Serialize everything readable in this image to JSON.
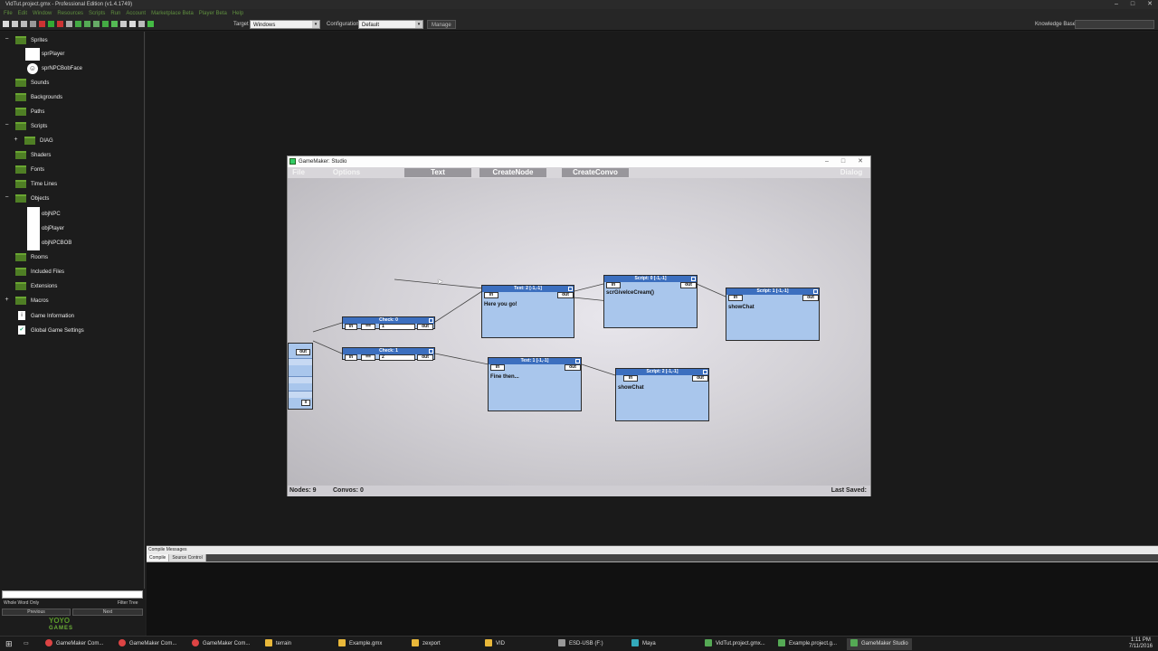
{
  "window": {
    "title": "VidTut.project.gmx  -  Professional Edition (v1.4.1749)",
    "controls": [
      "–",
      "□",
      "✕"
    ]
  },
  "menu": [
    "File",
    "Edit",
    "Window",
    "Resources",
    "Scripts",
    "Run",
    "Account",
    "Marketplace Beta",
    "Player Beta",
    "Help"
  ],
  "toolbar": {
    "target_label": "Target",
    "target_value": "Windows",
    "config_label": "Configuration",
    "config_value": "Default",
    "manage_label": "Manage",
    "knowledge_label": "Knowledge Base"
  },
  "tree": {
    "sprites": "Sprites",
    "spr_player": "sprPlayer",
    "spr_npc_face": "sprNPCBobFace",
    "sounds": "Sounds",
    "backgrounds": "Backgrounds",
    "paths": "Paths",
    "scripts": "Scripts",
    "diag": "DIAG",
    "shaders": "Shaders",
    "fonts": "Fonts",
    "time_lines": "Time Lines",
    "objects": "Objects",
    "obj_npc": "objNPC",
    "obj_player": "objPlayer",
    "obj_npc_bob": "objNPCBOB",
    "rooms": "Rooms",
    "included_files": "Included Files",
    "extensions": "Extensions",
    "macros": "Macros",
    "game_information": "Game Information",
    "global_game_settings": "Global Game Settings"
  },
  "tree_footer": {
    "whole_word": "Whole Word Only",
    "filter_tree": "Filter Tree",
    "previous": "Previous",
    "next": "Next",
    "brand": "YOYO",
    "brand_sub": "GAMES"
  },
  "compile": {
    "title": "Compile Messages",
    "tab_compile": "Compile",
    "tab_source": "Source Control"
  },
  "gm_window": {
    "title": "GameMaker: Studio",
    "menu_file": "File",
    "menu_options": "Options",
    "menu_text": "Text",
    "menu_create_node": "CreateNode",
    "menu_create_convo": "CreateConvo",
    "menu_dialog": "Dialog",
    "status_nodes": "Nodes: 9",
    "status_convos": "Convos: 0",
    "status_last_saved": "Last Saved:"
  },
  "nodes": {
    "start_out": "out",
    "check0_title": "Check: 0",
    "check0_in": "in",
    "check0_op": "==",
    "check0_val": "1",
    "check0_out": "out",
    "check1_title": "Check: 1",
    "check1_in": "in",
    "check1_op": "==",
    "check1_val": "2",
    "check1_out": "out",
    "text2_title": "Text: 2  [-1,-1]",
    "text2_in": "in",
    "text2_out": "out",
    "text2_body": "Here you go!",
    "text1_title": "Text: 1  [-1,-1]",
    "text1_in": "in",
    "text1_out": "out",
    "text1_body": "Fine then...",
    "script0_title": "Script: 0  [-1,-1]",
    "script0_in": "in",
    "script0_out": "out",
    "script0_body": "scrGiveIceCream()",
    "script1_title": "Script: 1  [-1,-1]",
    "script1_in": "in",
    "script1_out": "out",
    "script1_body": "showChat",
    "script2_title": "Script: 2  [-1,-1]",
    "script2_in": "in",
    "script2_out": "out",
    "script2_body": "showChat"
  },
  "taskbar": {
    "items": [
      "GameMaker Com...",
      "GameMaker Com...",
      "GameMaker Com...",
      "terrain",
      "Example.gmx",
      "zexport",
      "VID",
      "ESD-USB (F:)",
      "Maya",
      "VidTut.project.gmx...",
      "Example.project.g...",
      "GameMaker Studio"
    ],
    "time": "1:11 PM",
    "date": "7/11/2016"
  },
  "colors": {
    "folder": "#4f7f25",
    "node_header": "#3c6fbf",
    "node_body": "#a9c6ec",
    "menu_green": "#5f8f3f"
  }
}
